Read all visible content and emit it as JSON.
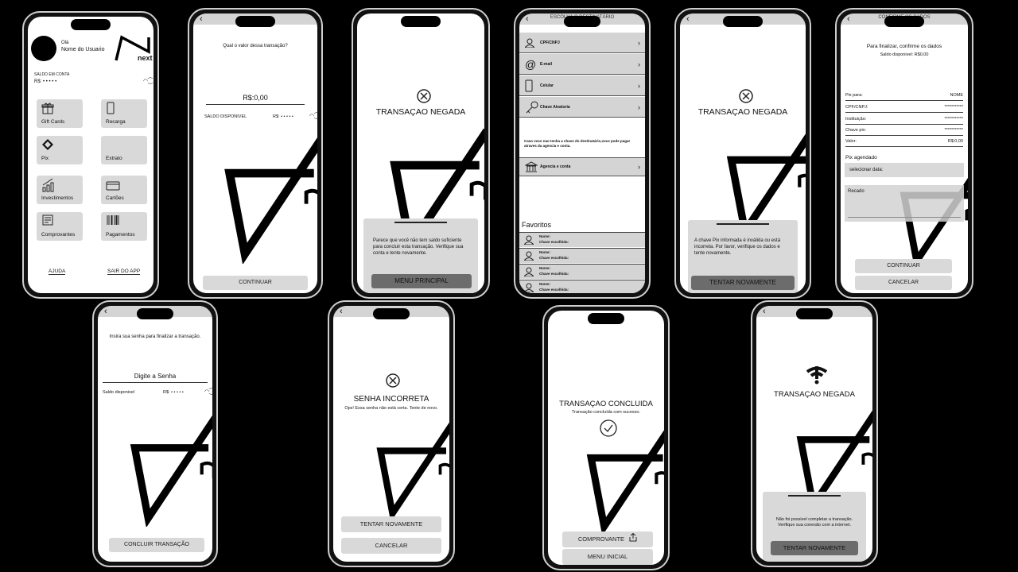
{
  "screens": {
    "home": {
      "greeting": "Olá",
      "user_name": "Nome do Usuario",
      "brand": "next",
      "balance_label": "SALDO EM CONTA",
      "balance_value": "R$: • • • • •",
      "tiles": [
        "Gift Cards",
        "Recarga",
        "Pix",
        "Extrato",
        "Investimentos",
        "Cartões",
        "Comprovantes",
        "Pagamentos"
      ],
      "help": "AJUDA",
      "logout": "SAIR DO APP"
    },
    "amount": {
      "question": "Qual o valor dessa transação?",
      "amount": "R$:0,00",
      "balance_label": "SALDO DISPONIVEL",
      "balance_value": "R$: • • • • •",
      "continue": "CONTINUAR"
    },
    "denied_balance": {
      "title": "TRANSAÇAO NEGADA",
      "message": "Parece que você não tem saldo suficiente para concluir esta transação. Verifique sua conta e tente novamente.",
      "button": "MENU PRINCIPAL"
    },
    "recipient": {
      "title": "ESCOLHA O DESTINATÁRIO",
      "options": [
        "CPF/CNPJ",
        "E-mail",
        "Celular",
        "Chave Aleatoria"
      ],
      "note": "Caso voce nao tenha a chave do destinatário,voce pode pagar atraves da agencia e conta.",
      "agency": "Agencia e conta",
      "favorites_title": "Favoritos",
      "fav_name": "Nome:",
      "fav_key": "Chave escolhida:"
    },
    "denied_key": {
      "title": "TRANSAÇAO NEGADA",
      "message": "A chave Pix informada é inválida ou está incorreta. Por favor, verifique os dados e tente novamente.",
      "button": "TENTAR NOVAMENTE"
    },
    "confirm": {
      "title": "CONFIRME OS DADOS",
      "heading": "Para finalizar, confirme os dados",
      "balance": "Saldo disponivel: R$0,00",
      "fields": [
        {
          "label": "Pix para:",
          "value": "NOME"
        },
        {
          "label": "CPF/CNPJ:",
          "value": "***********"
        },
        {
          "label": "Instituição:",
          "value": "***********"
        },
        {
          "label": "Chave pix:",
          "value": "***********"
        },
        {
          "label": "Valor:",
          "value": "R$:0,00"
        }
      ],
      "scheduled": "Pix agendado",
      "select_date": "selecionar data:",
      "note_label": "Recado",
      "continue": "CONTINUAR",
      "cancel": "CANCELAR"
    },
    "password": {
      "instruction": "Insira sua senha para finalizar a transação.",
      "field": "Digite a Senha",
      "balance_label": "Saldo disponivel",
      "balance_value": "R$: • • • • •",
      "button": "CONCLUIR TRANSAÇÃO"
    },
    "wrong_password": {
      "title": "SENHA INCORRETA",
      "message": "Ops! Essa senha não está certa. Tente de novo.",
      "retry": "TENTAR NOVAMENTE",
      "cancel": "CANCELAR"
    },
    "success": {
      "title": "TRANSAÇAO CONCLUIDA",
      "subtitle": "Transação concluída com sucesso.",
      "receipt": "COMPROVANTE",
      "home": "MENU INICIAL"
    },
    "denied_network": {
      "title": "TRANSAÇAO NEGADA",
      "message": "Não foi possivel completar a transação. Verifique sua conexão com a internet.",
      "button": "TENTAR NOVAMENTE"
    }
  }
}
